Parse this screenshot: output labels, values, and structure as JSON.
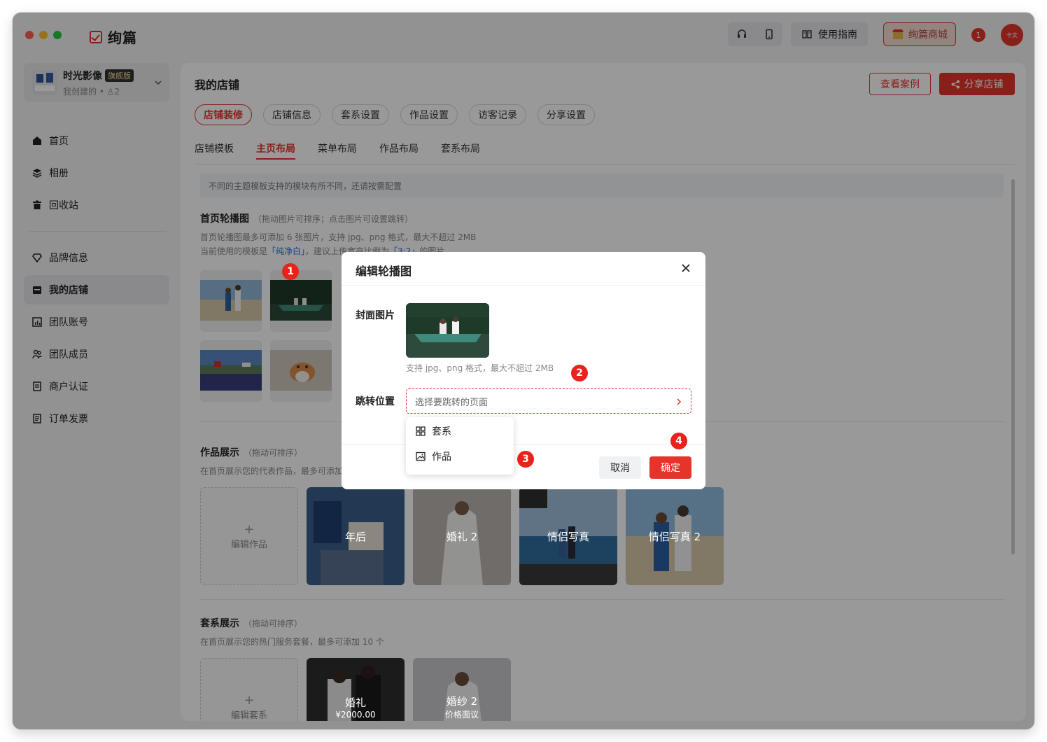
{
  "app": {
    "logo_text": "绚篇"
  },
  "titlebar": {
    "guide_label": "使用指南",
    "shop_label": "绚篇商城",
    "notif_count": "1",
    "avatar_text": "卡文"
  },
  "workspace": {
    "name": "时光影像",
    "badge": "旗舰版",
    "meta": "我创建的 • ♙2"
  },
  "nav": {
    "items": [
      {
        "label": "首页",
        "icon": "home-icon"
      },
      {
        "label": "相册",
        "icon": "layers-icon"
      },
      {
        "label": "回收站",
        "icon": "trash-icon"
      },
      {
        "label": "品牌信息",
        "icon": "diamond-icon"
      },
      {
        "label": "我的店铺",
        "icon": "store-icon"
      },
      {
        "label": "团队账号",
        "icon": "chart-icon"
      },
      {
        "label": "团队成员",
        "icon": "users-icon"
      },
      {
        "label": "商户认证",
        "icon": "doc-icon"
      },
      {
        "label": "订单发票",
        "icon": "invoice-icon"
      }
    ],
    "active": "我的店铺"
  },
  "page": {
    "title": "我的店铺",
    "view_cases": "查看案例",
    "share_store": "分享店铺",
    "tabs": [
      "店铺装修",
      "店铺信息",
      "套系设置",
      "作品设置",
      "访客记录",
      "分享设置"
    ],
    "subtabs": [
      "店铺模板",
      "主页布局",
      "菜单布局",
      "作品布局",
      "套系布局"
    ],
    "notice": "不同的主题模板支持的模块有所不同，还请按需配置",
    "carousel": {
      "title": "首页轮播图",
      "hint": "（拖动图片可排序；点击图片可设置跳转）",
      "desc1": "首页轮播图最多可添加 6 张图片，支持 jpg、png 格式，最大不超过 2MB",
      "desc2_prefix": "当前使用的模板是",
      "template_name": "「纯净白」",
      "desc2_mid": "，建议上传宽高比例为",
      "ratio": "「3:2」",
      "desc2_suffix": "的图片"
    },
    "works": {
      "title": "作品展示",
      "hint": "（拖动可排序）",
      "desc": "在首页展示您的代表作品，最多可添加",
      "add_label": "编辑作品",
      "cards": [
        "年后",
        "婚礼 2",
        "情侣写真",
        "情侣写真 2"
      ]
    },
    "packages": {
      "title": "套系展示",
      "hint": "（拖动可排序）",
      "desc": "在首页展示您的热门服务套餐，最多可添加 10 个",
      "add_label": "编辑套系",
      "cards": [
        {
          "name": "婚礼",
          "price": "¥2000.00"
        },
        {
          "name": "婚纱 2",
          "price": "价格面议"
        }
      ]
    }
  },
  "modal": {
    "title": "编辑轮播图",
    "cover_label": "封面图片",
    "cover_hint": "支持 jpg、png 格式，最大不超过 2MB",
    "jump_label": "跳转位置",
    "jump_placeholder": "选择要跳转的页面",
    "dropdown": [
      {
        "label": "套系",
        "icon": "grid-icon"
      },
      {
        "label": "作品",
        "icon": "image-icon"
      }
    ],
    "cancel": "取消",
    "confirm": "确定"
  },
  "badges": [
    "1",
    "2",
    "3",
    "4"
  ],
  "colors": {
    "accent": "#e5352b",
    "badge": "#e8231b"
  }
}
